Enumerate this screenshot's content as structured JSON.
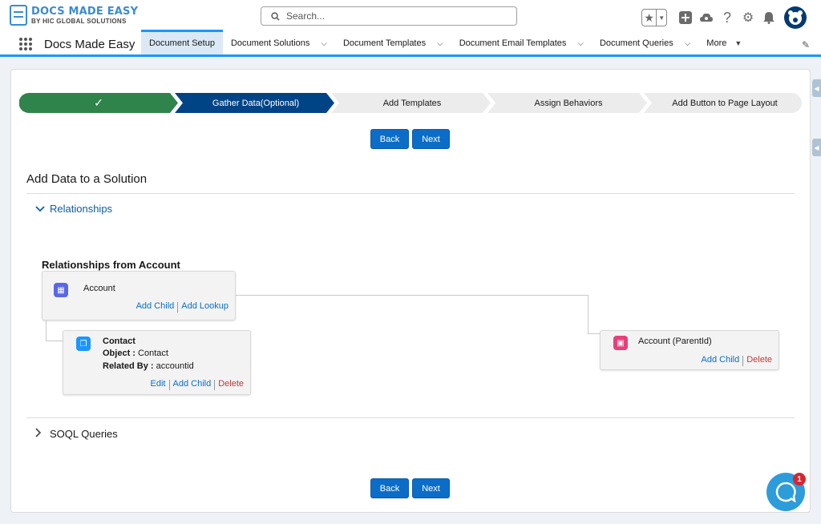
{
  "header": {
    "logo_title": "DOCS MADE EASY",
    "logo_subtitle": "BY HIC GLOBAL SOLUTIONS",
    "search_placeholder": "Search...",
    "icons": [
      "star-icon",
      "chevron-down-icon",
      "plus-icon",
      "cloud-icon",
      "help-icon",
      "gear-icon",
      "bell-icon",
      "avatar"
    ]
  },
  "nav": {
    "app_name": "Docs Made Easy",
    "tabs": [
      {
        "label": "Document Setup",
        "active": true,
        "has_menu": false
      },
      {
        "label": "Document Solutions",
        "has_menu": true
      },
      {
        "label": "Document Templates",
        "has_menu": true
      },
      {
        "label": "Document Email Templates",
        "has_menu": true
      },
      {
        "label": "Document Queries",
        "has_menu": true
      },
      {
        "label": "More",
        "has_menu": true
      }
    ]
  },
  "path": {
    "stages": [
      {
        "label": "",
        "state": "complete",
        "icon": "check-icon"
      },
      {
        "label": "Gather Data(Optional)",
        "state": "current"
      },
      {
        "label": "Add Templates",
        "state": "incomplete"
      },
      {
        "label": "Assign Behaviors",
        "state": "incomplete"
      },
      {
        "label": "Add Button to Page Layout",
        "state": "incomplete"
      }
    ],
    "colors": {
      "complete": "#2e844a",
      "current": "#014486",
      "incomplete": "#ececec"
    }
  },
  "buttons": {
    "back": "Back",
    "next": "Next"
  },
  "section": {
    "title": "Add Data to a Solution",
    "relationships_label": "Relationships",
    "soql_label": "SOQL Queries",
    "rel_title": "Relationships from Account"
  },
  "nodes": {
    "account": {
      "name": "Account",
      "add_child": "Add Child",
      "add_lookup": "Add Lookup"
    },
    "contact": {
      "name": "Contact",
      "object_label": "Object :",
      "object_value": "Contact",
      "related_label": "Related By :",
      "related_value": "accountid",
      "edit": "Edit",
      "add_child": "Add Child",
      "delete": "Delete"
    },
    "parent": {
      "name": "Account (ParentId)",
      "add_child": "Add Child",
      "delete": "Delete"
    }
  },
  "chat": {
    "badge": "1"
  }
}
